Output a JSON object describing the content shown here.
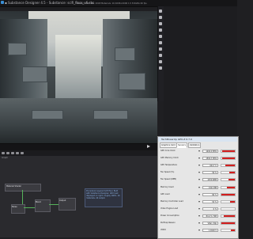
{
  "app": {
    "title": "▪ Substance Designer 4.5 - Substance: scifi_floor_v6.sbs"
  },
  "viewport": {
    "info": "Sbs-Tex: 4096  Tex: 2048  Materials: 16  4096×4096  1.5  8 RGBA  60 fps"
  },
  "graph": {
    "label": "Graph",
    "nodes": [
      {
        "title": "Material Shader"
      },
      {
        "title": "Noise"
      },
      {
        "title": "Blend"
      },
      {
        "title": "Output"
      }
    ],
    "comment": "Procedural Layered Scifi floor. Built with Substance Designer. GPU load displayed on right, roughly 100%. 16 materials, 4K output."
  },
  "gpuz": {
    "title": "TechPowerUp GPU-Z 0.7.0",
    "tabs": [
      "Graphics Card",
      "Sensors",
      "Validation"
    ],
    "active_tab": "Sensors",
    "sensors": [
      {
        "label": "GPU Core Clock",
        "value": "1202.0 MHz",
        "fill": 0.95
      },
      {
        "label": "GPU Memory Clock",
        "value": "1502.3 MHz",
        "fill": 0.95
      },
      {
        "label": "GPU Temperature",
        "value": "69.0 °C",
        "fill": 0.7
      },
      {
        "label": "Fan Speed (%)",
        "value": "39 %",
        "fill": 0.4
      },
      {
        "label": "Fan Speed (RPM)",
        "value": "2250 RPM",
        "fill": 0.45
      },
      {
        "label": "Memory Used",
        "value": "1911 MB",
        "fill": 0.6
      },
      {
        "label": "GPU Load",
        "value": "99 %",
        "fill": 0.99
      },
      {
        "label": "Memory Controller Load",
        "value": "32 %",
        "fill": 0.35
      },
      {
        "label": "Video Engine Load",
        "value": "0 %",
        "fill": 0.0
      },
      {
        "label": "Power Consumption",
        "value": "84.4 % TDP",
        "fill": 0.85
      },
      {
        "label": "PerfCap Reason",
        "value": "VRel, VOp",
        "fill": 1.0
      },
      {
        "label": "VDDC",
        "value": "1.1620 V",
        "fill": 0.3
      }
    ]
  },
  "colors": {
    "sensor_bar": "#d21e1e",
    "wire": "#55b35a",
    "comment": "#8fb6e8"
  },
  "icons": [
    "logo-icon",
    "play-icon",
    "tool-icon"
  ]
}
